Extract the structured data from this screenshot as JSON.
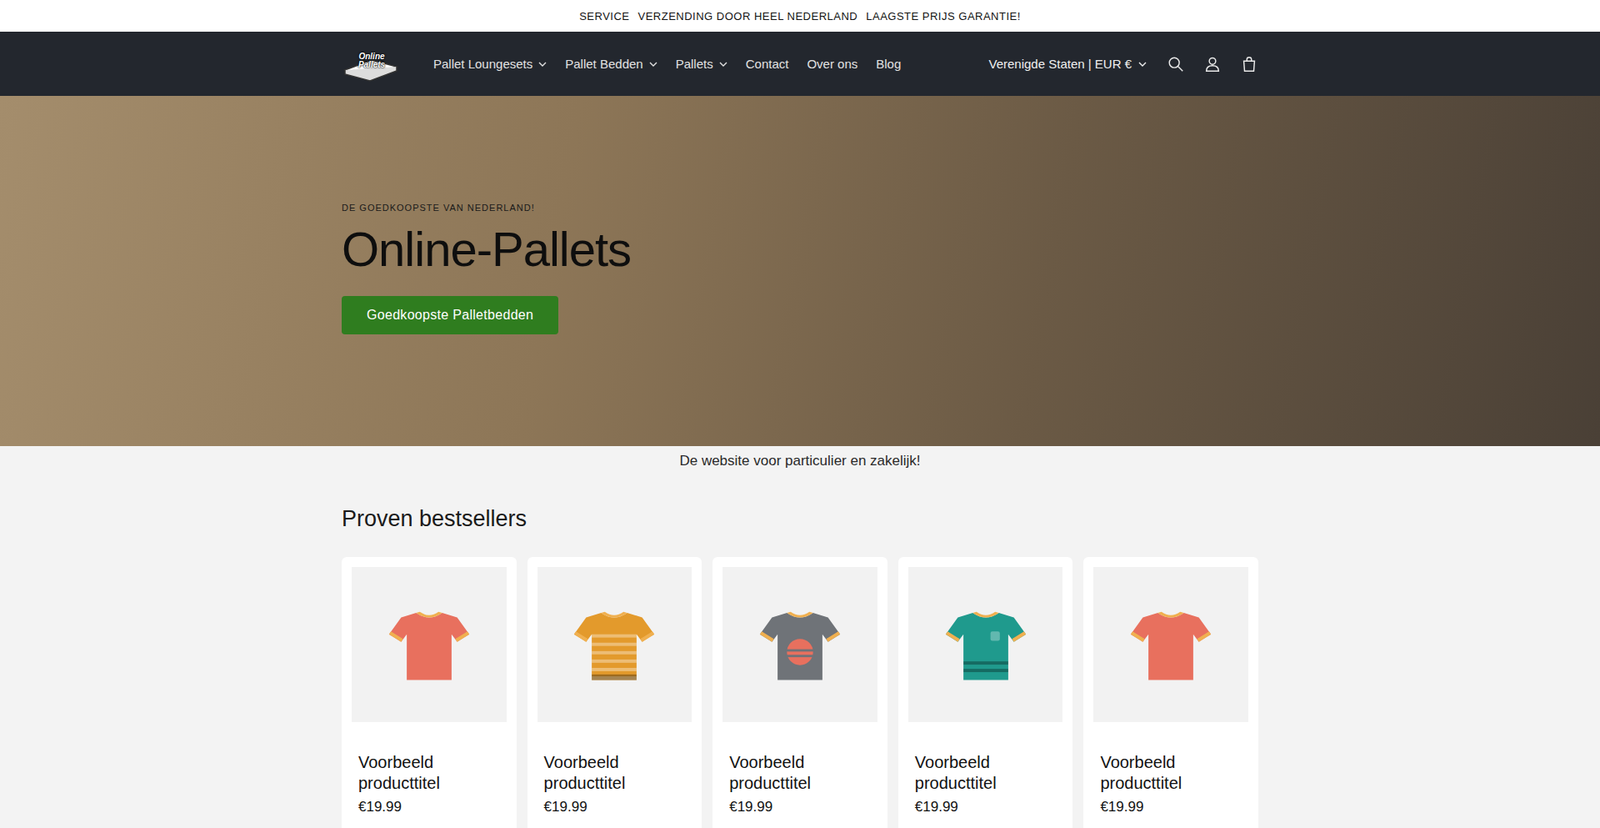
{
  "announcement": [
    "SERVICE",
    "VERZENDING DOOR HEEL NEDERLAND",
    "LAAGSTE PRIJS GARANTIE!"
  ],
  "header": {
    "logo": "Online Pallets",
    "nav": [
      {
        "label": "Pallet Loungesets",
        "expandable": true
      },
      {
        "label": "Pallet Bedden",
        "expandable": true
      },
      {
        "label": "Pallets",
        "expandable": true
      },
      {
        "label": "Contact",
        "expandable": false
      },
      {
        "label": "Over ons",
        "expandable": false
      },
      {
        "label": "Blog",
        "expandable": false
      }
    ],
    "locale": "Verenigde Staten | EUR €"
  },
  "hero": {
    "subtitle": "DE GOEDKOOPSTE VAN NEDERLAND!",
    "title": "Online-Pallets",
    "button": "Goedkoopste Palletbedden"
  },
  "tagline": "De website voor particulier en zakelijk!",
  "collection": {
    "title": "Proven bestsellers",
    "products": [
      {
        "title": "Voorbeeld producttitel",
        "price": "€19.99",
        "color": "#e8705e",
        "kind": "plain"
      },
      {
        "title": "Voorbeeld producttitel",
        "price": "€19.99",
        "color": "#e39a2c",
        "kind": "striped"
      },
      {
        "title": "Voorbeeld producttitel",
        "price": "€19.99",
        "color": "#6f7378",
        "kind": "sun"
      },
      {
        "title": "Voorbeeld producttitel",
        "price": "€19.99",
        "color": "#1f9a8d",
        "kind": "pocket"
      },
      {
        "title": "Voorbeeld producttitel",
        "price": "€19.99",
        "color": "#e8705e",
        "kind": "plain"
      }
    ]
  }
}
